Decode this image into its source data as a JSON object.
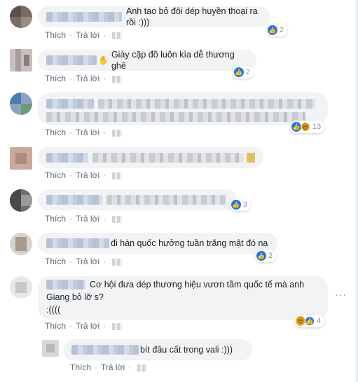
{
  "actions": {
    "like": "Thích",
    "reply": "Trả lời",
    "separator": "·"
  },
  "comments": [
    {
      "text": "Anh tao bỏ đôi dép huyền thoại ra rồi :)))",
      "reactions": "2"
    },
    {
      "text": "Giày cặp đồ luôn kìa dễ thương ghê",
      "reactions": "2"
    },
    {
      "text": "",
      "reactions": "13"
    },
    {
      "text": "",
      "reactions": ""
    },
    {
      "text": "",
      "reactions": "3"
    },
    {
      "text": "đi hàn quốc hưởng tuần trăng mật đó nạ",
      "reactions": "2"
    },
    {
      "text_line1": "Cơ hội đưa dép thương hiệu vươn tầm quốc tế mà anh",
      "text_line2": "Giang bỏ lỡ s?",
      "text_line3": ":((((",
      "reactions": "4"
    },
    {
      "text": "bít đâu cất trong vali :)))",
      "reactions": ""
    }
  ],
  "icons": {
    "like": "like-icon",
    "haha": "haha-icon",
    "wave": "waving-hand-icon",
    "more": "more-options-icon"
  },
  "colors": {
    "bubble": "#f2f3f5",
    "link": "#616770",
    "like": "#1877f2",
    "haha": "#f7b125"
  }
}
